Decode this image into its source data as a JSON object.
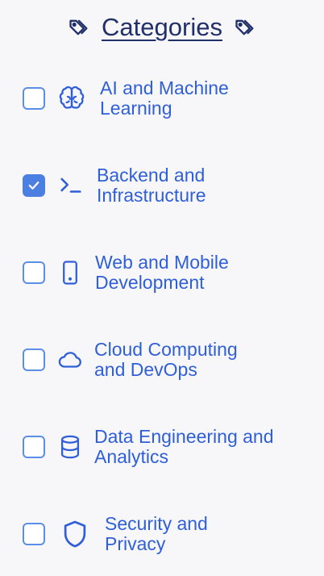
{
  "header": {
    "title": "Categories"
  },
  "categories": [
    {
      "label_line1": "AI and Machine",
      "label_line2": "Learning",
      "checked": false,
      "icon": "brain-icon"
    },
    {
      "label_line1": "Backend and",
      "label_line2": "Infrastructure",
      "checked": true,
      "icon": "terminal-icon"
    },
    {
      "label_line1": "Web and Mobile",
      "label_line2": "Development",
      "checked": false,
      "icon": "smartphone-icon"
    },
    {
      "label_line1": "Cloud Computing",
      "label_line2": "and DevOps",
      "checked": false,
      "icon": "cloud-icon"
    },
    {
      "label_line1": "Data Engineering and",
      "label_line2": "Analytics",
      "checked": false,
      "icon": "database-icon"
    },
    {
      "label_line1": "Security and",
      "label_line2": "Privacy",
      "checked": false,
      "icon": "shield-icon"
    }
  ],
  "colors": {
    "accent": "#2f5fd8",
    "checkbox_border": "#5b8ee8",
    "checkbox_checked": "#4c7fe2",
    "header_text": "#22306a",
    "background": "#f7f7f9"
  }
}
